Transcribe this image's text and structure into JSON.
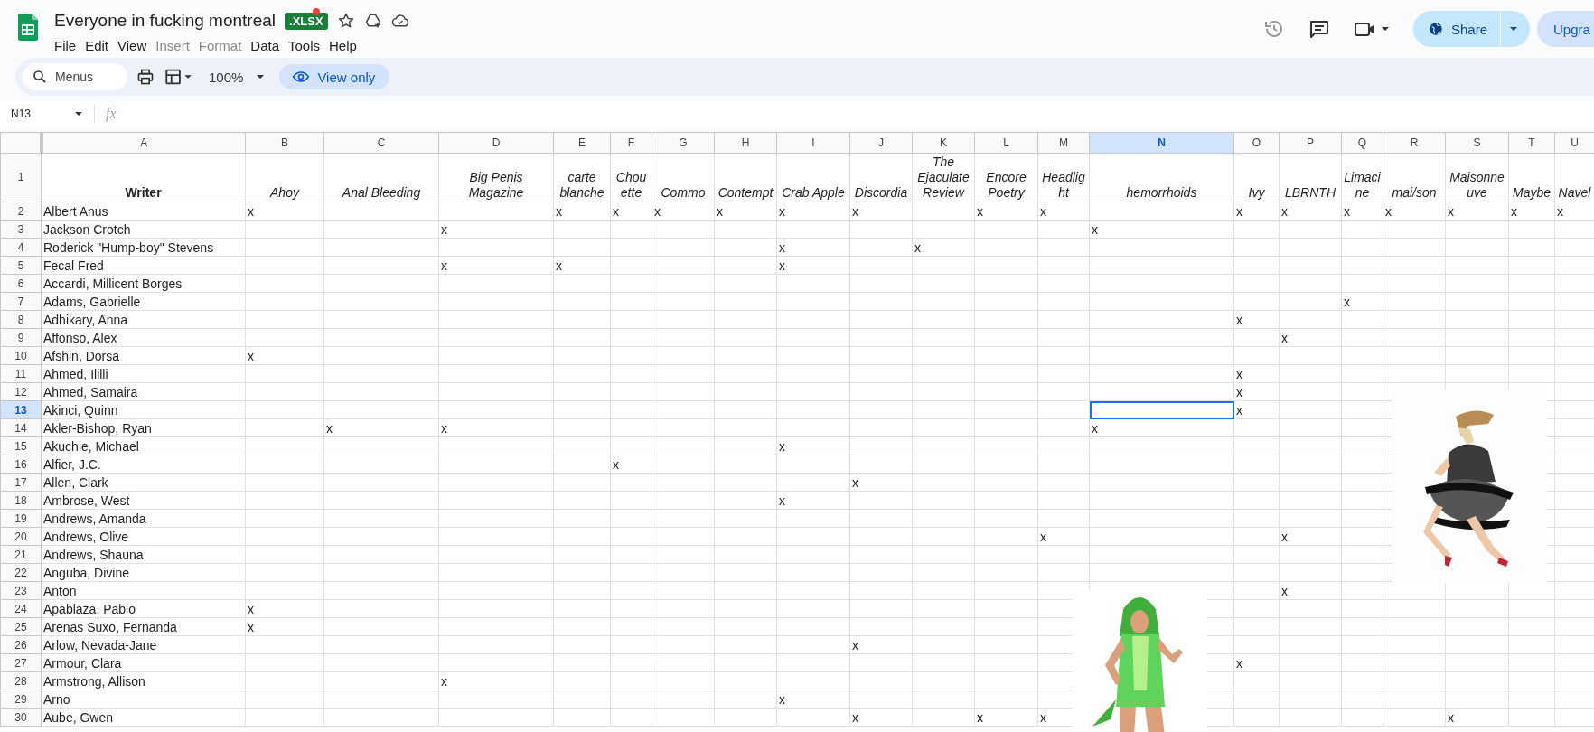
{
  "app": {
    "title": "Everyone in fucking montreal",
    "file_badge": ".XLSX",
    "menu": [
      {
        "label": "File",
        "disabled": false
      },
      {
        "label": "Edit",
        "disabled": false
      },
      {
        "label": "View",
        "disabled": false
      },
      {
        "label": "Insert",
        "disabled": true
      },
      {
        "label": "Format",
        "disabled": true
      },
      {
        "label": "Data",
        "disabled": false
      },
      {
        "label": "Tools",
        "disabled": false
      },
      {
        "label": "Help",
        "disabled": false
      }
    ],
    "share": "Share",
    "upgrade": "Upgra"
  },
  "toolbar": {
    "search": "Menus",
    "zoom": "100%",
    "view_only": "View only"
  },
  "formula_bar": {
    "name_box": "N13",
    "fx": "fx"
  },
  "sheet": {
    "columns": [
      {
        "letter": "A",
        "selected": false
      },
      {
        "letter": "B",
        "selected": false
      },
      {
        "letter": "C",
        "selected": false
      },
      {
        "letter": "D",
        "selected": false
      },
      {
        "letter": "E",
        "selected": false
      },
      {
        "letter": "F",
        "selected": false
      },
      {
        "letter": "G",
        "selected": false
      },
      {
        "letter": "H",
        "selected": false
      },
      {
        "letter": "I",
        "selected": false
      },
      {
        "letter": "J",
        "selected": false
      },
      {
        "letter": "K",
        "selected": false
      },
      {
        "letter": "L",
        "selected": false
      },
      {
        "letter": "M",
        "selected": false
      },
      {
        "letter": "N",
        "selected": true
      },
      {
        "letter": "O",
        "selected": false
      },
      {
        "letter": "P",
        "selected": false
      },
      {
        "letter": "Q",
        "selected": false
      },
      {
        "letter": "R",
        "selected": false
      },
      {
        "letter": "S",
        "selected": false
      },
      {
        "letter": "T",
        "selected": false
      },
      {
        "letter": "U",
        "selected": false
      }
    ],
    "rows": [
      {
        "number": "1",
        "kind": "header",
        "selected": false,
        "cells": [
          "Writer",
          "Ahoy",
          "Anal Bleeding",
          "Big Penis Magazine",
          "carte blanche",
          "Chouette",
          "Commo",
          "Contempt",
          "Crab Apple",
          "Discordia",
          "The Ejaculate Review",
          "Encore Poetry",
          "Headlight",
          "hemorrhoids",
          "Ivy",
          "LBRNTH",
          "Limacine",
          "mai/son",
          "Maisonneuve",
          "Maybe",
          "Navel"
        ]
      },
      {
        "number": "2",
        "kind": "data",
        "selected": false,
        "cells": [
          "Albert Anus",
          "x",
          null,
          null,
          "x",
          "x",
          "x",
          "x",
          "x",
          "x",
          null,
          "x",
          "x",
          null,
          "x",
          "x",
          "x",
          "x",
          "x",
          "x",
          "x"
        ]
      },
      {
        "number": "3",
        "kind": "data",
        "selected": false,
        "cells": [
          "Jackson Crotch",
          null,
          null,
          "x",
          null,
          null,
          null,
          null,
          null,
          null,
          null,
          null,
          null,
          "x",
          null,
          null,
          null,
          null,
          null,
          null,
          null
        ]
      },
      {
        "number": "4",
        "kind": "data",
        "selected": false,
        "cells": [
          "Roderick \"Hump-boy\" Stevens",
          null,
          null,
          null,
          null,
          null,
          null,
          null,
          "x",
          null,
          "x",
          null,
          null,
          null,
          null,
          null,
          null,
          null,
          null,
          null,
          null
        ]
      },
      {
        "number": "5",
        "kind": "data",
        "selected": false,
        "cells": [
          "Fecal Fred",
          null,
          null,
          "x",
          "x",
          null,
          null,
          null,
          "x",
          null,
          null,
          null,
          null,
          null,
          null,
          null,
          null,
          null,
          null,
          null,
          null
        ]
      },
      {
        "number": "6",
        "kind": "data",
        "selected": false,
        "cells": [
          "Accardi, Millicent Borges",
          null,
          null,
          null,
          null,
          null,
          null,
          null,
          null,
          null,
          null,
          null,
          null,
          null,
          null,
          null,
          null,
          null,
          null,
          null,
          null
        ]
      },
      {
        "number": "7",
        "kind": "data",
        "selected": false,
        "cells": [
          "Adams, Gabrielle",
          null,
          null,
          null,
          null,
          null,
          null,
          null,
          null,
          null,
          null,
          null,
          null,
          null,
          null,
          null,
          "x",
          null,
          null,
          null,
          null
        ]
      },
      {
        "number": "8",
        "kind": "data",
        "selected": false,
        "cells": [
          "Adhikary, Anna",
          null,
          null,
          null,
          null,
          null,
          null,
          null,
          null,
          null,
          null,
          null,
          null,
          null,
          "x",
          null,
          null,
          null,
          null,
          null,
          null
        ]
      },
      {
        "number": "9",
        "kind": "data",
        "selected": false,
        "cells": [
          "Affonso, Alex",
          null,
          null,
          null,
          null,
          null,
          null,
          null,
          null,
          null,
          null,
          null,
          null,
          null,
          null,
          "x",
          null,
          null,
          null,
          null,
          null
        ]
      },
      {
        "number": "10",
        "kind": "data",
        "selected": false,
        "cells": [
          "Afshin, Dorsa",
          "x",
          null,
          null,
          null,
          null,
          null,
          null,
          null,
          null,
          null,
          null,
          null,
          null,
          null,
          null,
          null,
          null,
          null,
          null,
          null
        ]
      },
      {
        "number": "11",
        "kind": "data",
        "selected": false,
        "cells": [
          "Ahmed, Ililli",
          null,
          null,
          null,
          null,
          null,
          null,
          null,
          null,
          null,
          null,
          null,
          null,
          null,
          "x",
          null,
          null,
          null,
          null,
          null,
          null
        ]
      },
      {
        "number": "12",
        "kind": "data",
        "selected": false,
        "cells": [
          "Ahmed, Samaira",
          null,
          null,
          null,
          null,
          null,
          null,
          null,
          null,
          null,
          null,
          null,
          null,
          null,
          "x",
          null,
          null,
          null,
          null,
          null,
          null
        ]
      },
      {
        "number": "13",
        "kind": "data",
        "selected": true,
        "cells": [
          "Akinci, Quinn",
          null,
          null,
          null,
          null,
          null,
          null,
          null,
          null,
          null,
          null,
          null,
          null,
          null,
          "x",
          null,
          null,
          null,
          null,
          null,
          null
        ]
      },
      {
        "number": "14",
        "kind": "data",
        "selected": false,
        "cells": [
          "Akler-Bishop, Ryan",
          null,
          "x",
          "x",
          null,
          null,
          null,
          null,
          null,
          null,
          null,
          null,
          null,
          "x",
          null,
          null,
          null,
          null,
          null,
          null,
          null
        ]
      },
      {
        "number": "15",
        "kind": "data",
        "selected": false,
        "cells": [
          "Akuchie, Michael",
          null,
          null,
          null,
          null,
          null,
          null,
          null,
          "x",
          null,
          null,
          null,
          null,
          null,
          null,
          null,
          null,
          null,
          null,
          null,
          null
        ]
      },
      {
        "number": "16",
        "kind": "data",
        "selected": false,
        "cells": [
          "Alfier, J.C.",
          null,
          null,
          null,
          null,
          "x",
          null,
          null,
          null,
          null,
          null,
          null,
          null,
          null,
          null,
          null,
          null,
          null,
          null,
          null,
          null
        ]
      },
      {
        "number": "17",
        "kind": "data",
        "selected": false,
        "cells": [
          "Allen, Clark",
          null,
          null,
          null,
          null,
          null,
          null,
          null,
          null,
          "x",
          null,
          null,
          null,
          null,
          null,
          null,
          null,
          null,
          null,
          null,
          null
        ]
      },
      {
        "number": "18",
        "kind": "data",
        "selected": false,
        "cells": [
          "Ambrose, West",
          null,
          null,
          null,
          null,
          null,
          null,
          null,
          "x",
          null,
          null,
          null,
          null,
          null,
          null,
          null,
          null,
          null,
          null,
          null,
          null
        ]
      },
      {
        "number": "19",
        "kind": "data",
        "selected": false,
        "cells": [
          "Andrews, Amanda",
          null,
          null,
          null,
          null,
          null,
          null,
          null,
          null,
          null,
          null,
          null,
          null,
          null,
          null,
          null,
          null,
          null,
          null,
          null,
          null
        ]
      },
      {
        "number": "20",
        "kind": "data",
        "selected": false,
        "cells": [
          "Andrews, Olive",
          null,
          null,
          null,
          null,
          null,
          null,
          null,
          null,
          null,
          null,
          null,
          "x",
          null,
          null,
          "x",
          null,
          null,
          null,
          null,
          null
        ]
      },
      {
        "number": "21",
        "kind": "data",
        "selected": false,
        "cells": [
          "Andrews, Shauna",
          null,
          null,
          null,
          null,
          null,
          null,
          null,
          null,
          null,
          null,
          null,
          null,
          null,
          null,
          null,
          null,
          null,
          null,
          null,
          null
        ]
      },
      {
        "number": "22",
        "kind": "data",
        "selected": false,
        "cells": [
          "Anguba, Divine",
          null,
          null,
          null,
          null,
          null,
          null,
          null,
          null,
          null,
          null,
          null,
          null,
          null,
          null,
          null,
          null,
          null,
          null,
          null,
          null
        ]
      },
      {
        "number": "23",
        "kind": "data",
        "selected": false,
        "cells": [
          "Anton",
          null,
          null,
          null,
          null,
          null,
          null,
          null,
          null,
          null,
          null,
          null,
          null,
          null,
          null,
          "x",
          null,
          null,
          null,
          null,
          null
        ]
      },
      {
        "number": "24",
        "kind": "data",
        "selected": false,
        "cells": [
          "Apablaza, Pablo",
          "x",
          null,
          null,
          null,
          null,
          null,
          null,
          null,
          null,
          null,
          null,
          null,
          null,
          null,
          null,
          null,
          null,
          null,
          null,
          null
        ]
      },
      {
        "number": "25",
        "kind": "data",
        "selected": false,
        "cells": [
          "Arenas Suxo, Fernanda",
          "x",
          null,
          null,
          null,
          null,
          null,
          null,
          null,
          null,
          null,
          null,
          null,
          null,
          null,
          null,
          null,
          null,
          null,
          null,
          null
        ]
      },
      {
        "number": "26",
        "kind": "data",
        "selected": false,
        "cells": [
          "Arlow, Nevada-Jane",
          null,
          null,
          null,
          null,
          null,
          null,
          null,
          null,
          "x",
          null,
          null,
          null,
          null,
          null,
          null,
          null,
          null,
          null,
          null,
          null
        ]
      },
      {
        "number": "27",
        "kind": "data",
        "selected": false,
        "cells": [
          "Armour, Clara",
          null,
          null,
          null,
          null,
          null,
          null,
          null,
          null,
          null,
          null,
          null,
          null,
          null,
          "x",
          null,
          null,
          null,
          null,
          null,
          null
        ]
      },
      {
        "number": "28",
        "kind": "data",
        "selected": false,
        "cells": [
          "Armstrong, Allison",
          null,
          null,
          "x",
          null,
          null,
          null,
          null,
          null,
          null,
          null,
          null,
          null,
          null,
          null,
          null,
          null,
          null,
          null,
          null,
          null
        ]
      },
      {
        "number": "29",
        "kind": "data",
        "selected": false,
        "cells": [
          "Arno",
          null,
          null,
          null,
          null,
          null,
          null,
          null,
          "x",
          null,
          null,
          null,
          null,
          null,
          null,
          null,
          null,
          null,
          null,
          null,
          null
        ]
      },
      {
        "number": "30",
        "kind": "data",
        "selected": false,
        "cells": [
          "Aube, Gwen",
          null,
          null,
          null,
          null,
          null,
          null,
          null,
          null,
          "x",
          null,
          "x",
          "x",
          null,
          null,
          null,
          null,
          null,
          "x",
          null,
          null
        ]
      }
    ]
  }
}
